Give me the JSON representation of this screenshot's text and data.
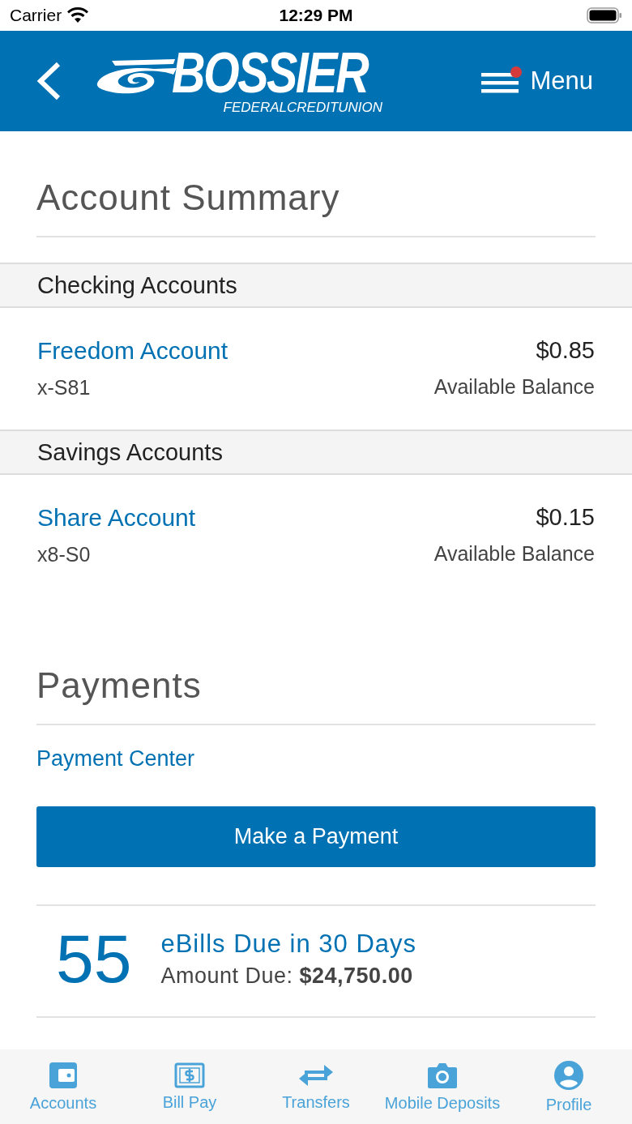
{
  "status_bar": {
    "carrier": "Carrier",
    "time": "12:29 PM"
  },
  "header": {
    "brand": "BOSSIER",
    "brand_subtitle": "FEDERALCREDITUNION",
    "menu": {
      "label": "Menu",
      "notification": true
    }
  },
  "account_summary": {
    "title": "Account Summary",
    "groups": [
      {
        "heading": "Checking Accounts",
        "accounts": [
          {
            "name": "Freedom Account",
            "number": "x-S81",
            "balance": "$0.85",
            "balance_label": "Available Balance"
          }
        ]
      },
      {
        "heading": "Savings Accounts",
        "accounts": [
          {
            "name": "Share Account",
            "number": "x8-S0",
            "balance": "$0.15",
            "balance_label": "Available Balance"
          }
        ]
      }
    ]
  },
  "payments": {
    "title": "Payments",
    "link": "Payment Center",
    "button": "Make a Payment",
    "ebills": {
      "count": "55",
      "title": "eBills Due in 30 Days",
      "amount": "Amount Due: **$24,750.00**"
    }
  },
  "tab_bar": [
    {
      "kind": "accounts",
      "label": "Accounts"
    },
    {
      "kind": "billpay",
      "label": "Bill Pay"
    },
    {
      "kind": "transfers",
      "label": "Transfers"
    },
    {
      "kind": "camera",
      "label": "Mobile Deposits"
    },
    {
      "kind": "profile",
      "label": "Profile"
    }
  ]
}
